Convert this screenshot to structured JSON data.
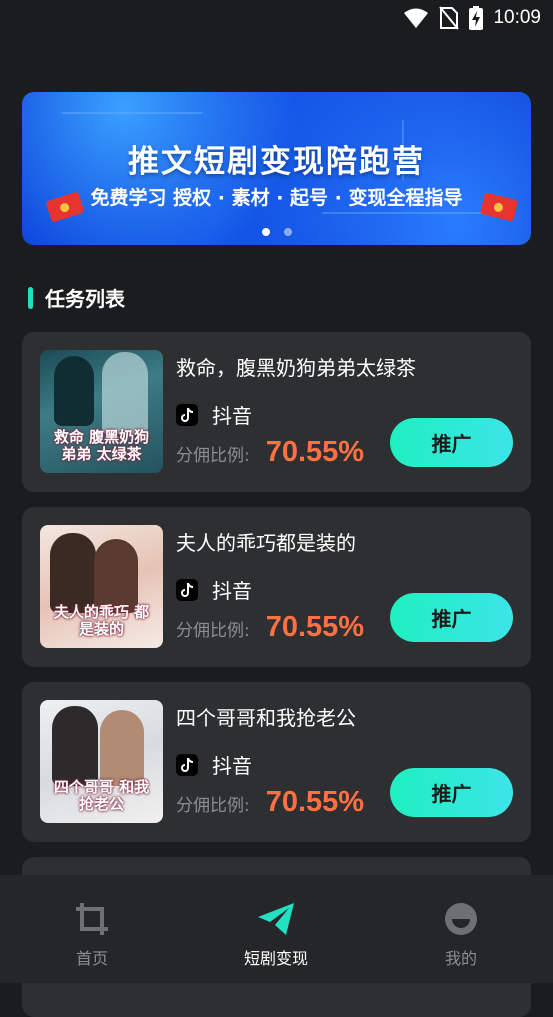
{
  "status_bar": {
    "time": "10:09"
  },
  "banner": {
    "title": "推文短剧变现陪跑营",
    "subtitle": "免费学习  授权 · 素材 · 起号 · 变现全程指导",
    "page_count": 2,
    "active_page": 1
  },
  "section": {
    "title": "任务列表"
  },
  "tasks": [
    {
      "name": "救命，腹黑奶狗弟弟太绿茶",
      "platform": "抖音",
      "ratio_label": "分佣比例:",
      "ratio_value": "70.55%",
      "button_label": "推广",
      "cover_text": "救命 腹黑奶狗弟弟 太绿茶"
    },
    {
      "name": "夫人的乖巧都是装的",
      "platform": "抖音",
      "ratio_label": "分佣比例:",
      "ratio_value": "70.55%",
      "button_label": "推广",
      "cover_text": "夫人的乖巧 都是装的"
    },
    {
      "name": "四个哥哥和我抢老公",
      "platform": "抖音",
      "ratio_label": "分佣比例:",
      "ratio_value": "70.55%",
      "button_label": "推广",
      "cover_text": "四个哥哥 和我抢老公"
    }
  ],
  "tab_bar": {
    "tabs": [
      {
        "label": "首页",
        "icon": "crop-icon",
        "active": false
      },
      {
        "label": "短剧变现",
        "icon": "paper-plane-icon",
        "active": true
      },
      {
        "label": "我的",
        "icon": "profile-icon",
        "active": false
      }
    ]
  },
  "colors": {
    "accent": "#20e0c0",
    "ratio": "#ff7043",
    "card_bg": "#2d2f31",
    "page_bg": "#1b1c1e"
  }
}
